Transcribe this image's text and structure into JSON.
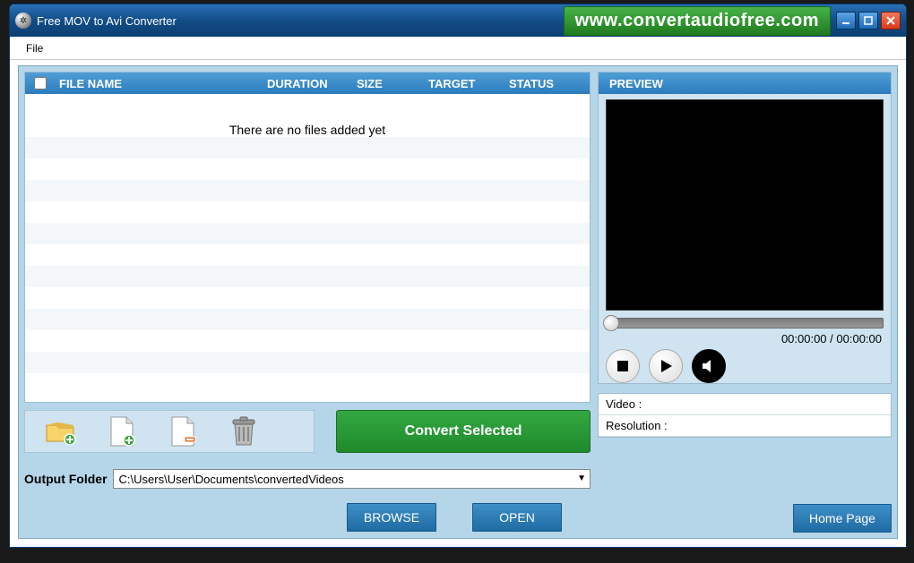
{
  "titlebar": {
    "title": "Free MOV to Avi Converter",
    "url": "www.convertaudiofree.com"
  },
  "menu": {
    "file": "File"
  },
  "grid": {
    "columns": {
      "name": "FILE NAME",
      "duration": "DURATION",
      "size": "SIZE",
      "target": "TARGET",
      "status": "STATUS"
    },
    "empty_message": "There are no files added yet"
  },
  "toolbar": {
    "convert": "Convert Selected"
  },
  "output": {
    "label": "Output Folder",
    "path": "C:\\Users\\User\\Documents\\convertedVideos"
  },
  "buttons": {
    "browse": "BROWSE",
    "open": "OPEN",
    "home": "Home Page"
  },
  "preview": {
    "title": "PREVIEW",
    "time_current": "00:00:00",
    "time_sep": " / ",
    "time_total": "00:00:00"
  },
  "info": {
    "video_label": "Video :",
    "video_value": "",
    "resolution_label": "Resolution :",
    "resolution_value": ""
  }
}
